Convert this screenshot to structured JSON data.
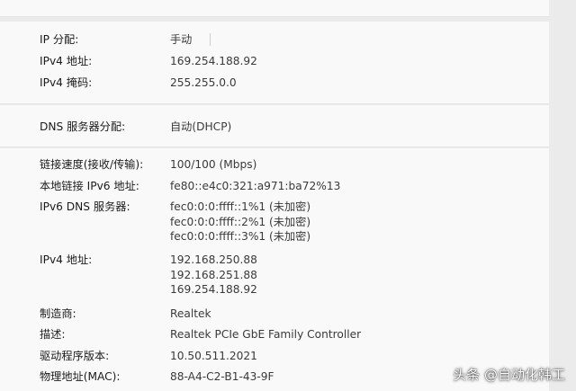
{
  "ip_section": {
    "rows": [
      {
        "label": "IP 分配:",
        "value": "手动"
      },
      {
        "label": "IPv4 地址:",
        "value": "169.254.188.92"
      },
      {
        "label": "IPv4 掩码:",
        "value": "255.255.0.0"
      }
    ]
  },
  "dns_section": {
    "rows": [
      {
        "label": "DNS 服务器分配:",
        "value": "自动(DHCP)"
      }
    ]
  },
  "details_section": {
    "link_speed": {
      "label": "链接速度(接收/传输):",
      "value": "100/100 (Mbps)"
    },
    "ipv6_link_local": {
      "label": "本地链接 IPv6 地址:",
      "value": "fe80::e4c0:321:a971:ba72%13"
    },
    "ipv6_dns": {
      "label": "IPv6 DNS 服务器:",
      "values": [
        "fec0:0:0:ffff::1%1 (未加密)",
        "fec0:0:0:ffff::2%1 (未加密)",
        "fec0:0:0:ffff::3%1 (未加密)"
      ]
    },
    "ipv4_address": {
      "label": "IPv4 地址:",
      "values": [
        "192.168.250.88",
        "192.168.251.88",
        "169.254.188.92"
      ]
    },
    "manufacturer": {
      "label": "制造商:",
      "value": "Realtek"
    },
    "description": {
      "label": "描述:",
      "value": "Realtek PCIe GbE Family Controller"
    },
    "driver_version": {
      "label": "驱动程序版本:",
      "value": "10.50.511.2021"
    },
    "mac": {
      "label": "物理地址(MAC):",
      "value": "88-A4-C2-B1-43-9F"
    }
  },
  "watermark": "头条 @自动化韩工"
}
